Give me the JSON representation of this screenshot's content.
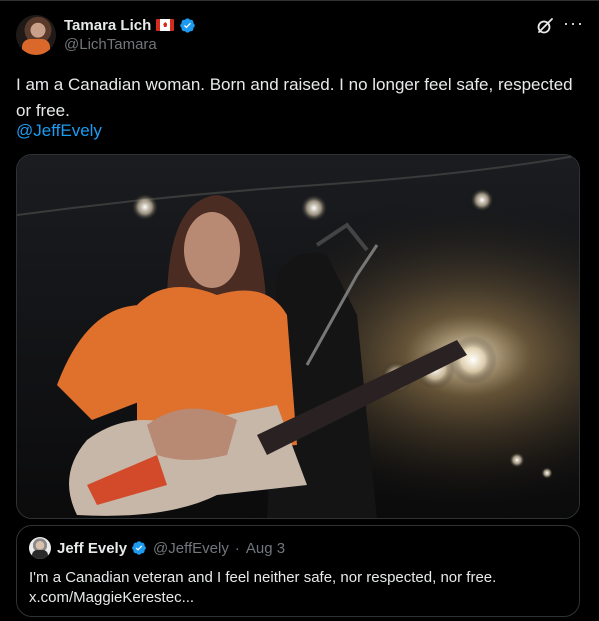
{
  "author": {
    "name": "Tamara Lich",
    "handle": "@LichTamara",
    "flag": "Canada flag emoji",
    "verified": true
  },
  "post": {
    "text": "I am a Canadian woman. Born and raised. I no longer feel safe, respected or free.",
    "mention": "@JeffEvely"
  },
  "quoted": {
    "name": "Jeff Evely",
    "handle": "@JeffEvely",
    "separator": "·",
    "date": "Aug 3",
    "text_line1": "I'm a Canadian veteran and I feel neither safe, nor respected, nor free.",
    "text_line2": "x.com/MaggieKerestec..."
  },
  "icons": {
    "verified": "verified-badge-icon",
    "grok": "grok-icon",
    "more": "more-options-icon"
  },
  "colors": {
    "background": "#000000",
    "text": "#e7e9ea",
    "muted": "#71767b",
    "link": "#1d9bf0",
    "border": "#2f3336",
    "verified": "#1d9bf0",
    "shirt": "#e0712c"
  }
}
